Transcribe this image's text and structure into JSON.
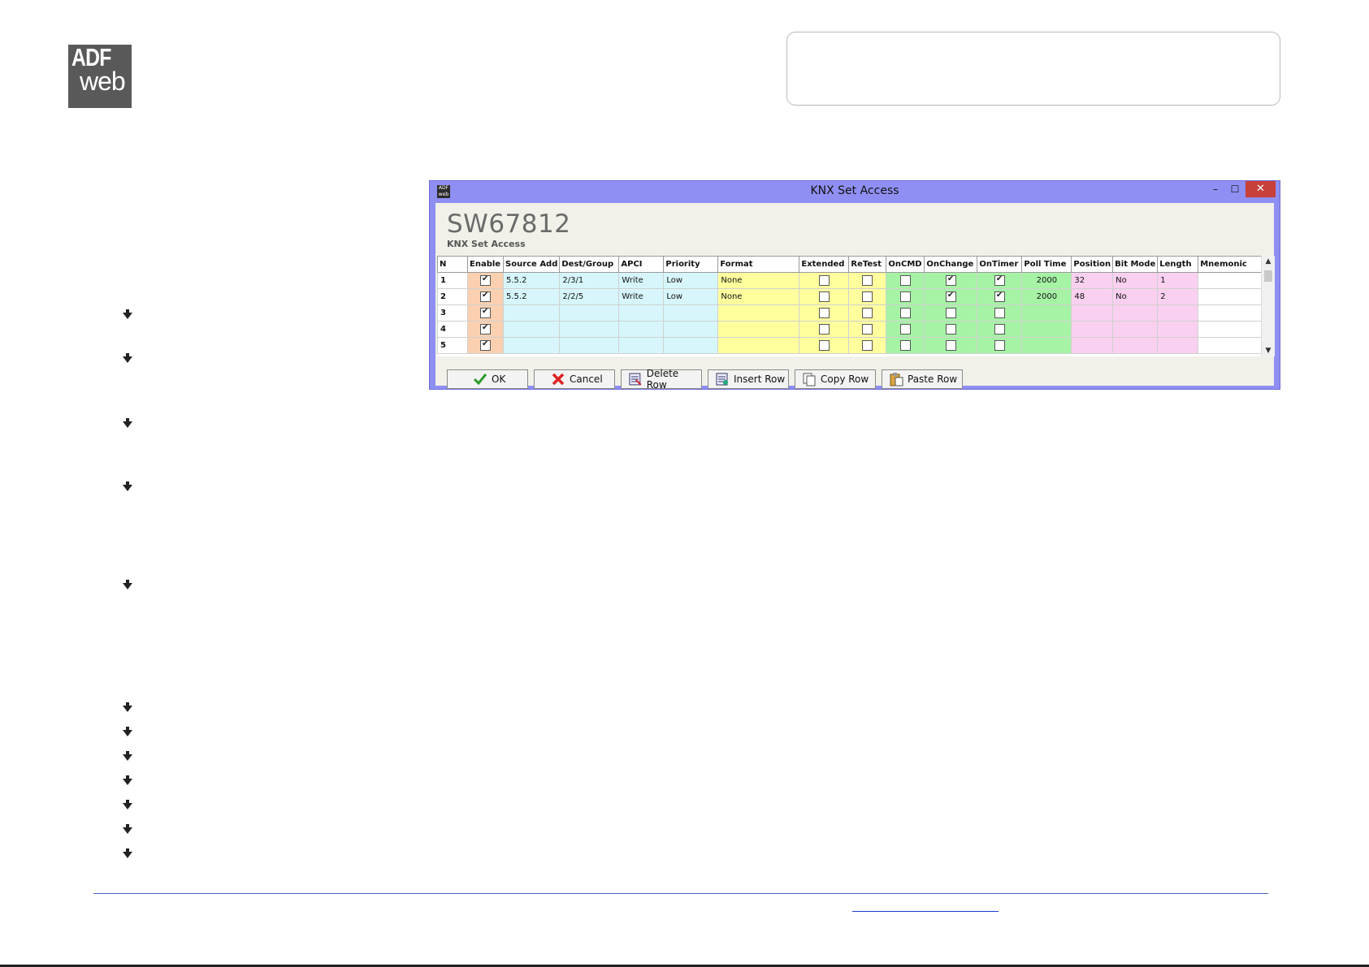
{
  "logo": {
    "line1": "ADF",
    "line2": "web"
  },
  "window": {
    "title": "KNX Set Access",
    "icon_text": "ADF web",
    "controls": {
      "minimize": "–",
      "maximize": "☐",
      "close": "✕"
    },
    "heading": "SW67812",
    "subheading": "KNX Set Access"
  },
  "grid": {
    "columns": [
      "N",
      "Enable",
      "Source Add",
      "Dest/Group",
      "APCI",
      "Priority",
      "Format",
      "Extended",
      "ReTest",
      "OnCMD",
      "OnChange",
      "OnTimer",
      "Poll Time",
      "Position",
      "Bit Mode",
      "Length",
      "Mnemonic"
    ],
    "rows": [
      {
        "n": "1",
        "enable": true,
        "source": "5.5.2",
        "dest": "2/3/1",
        "apci": "Write",
        "priority": "Low",
        "format": "None",
        "extended": false,
        "retest": false,
        "oncmd": false,
        "onchange": true,
        "ontimer": true,
        "poll": "2000",
        "position": "32",
        "bitmode": "No",
        "length": "1",
        "mnemonic": ""
      },
      {
        "n": "2",
        "enable": true,
        "source": "5.5.2",
        "dest": "2/2/5",
        "apci": "Write",
        "priority": "Low",
        "format": "None",
        "extended": false,
        "retest": false,
        "oncmd": false,
        "onchange": true,
        "ontimer": true,
        "poll": "2000",
        "position": "48",
        "bitmode": "No",
        "length": "2",
        "mnemonic": ""
      },
      {
        "n": "3",
        "enable": true,
        "source": "",
        "dest": "",
        "apci": "",
        "priority": "",
        "format": "",
        "extended": false,
        "retest": false,
        "oncmd": false,
        "onchange": false,
        "ontimer": false,
        "poll": "",
        "position": "",
        "bitmode": "",
        "length": "",
        "mnemonic": ""
      },
      {
        "n": "4",
        "enable": true,
        "source": "",
        "dest": "",
        "apci": "",
        "priority": "",
        "format": "",
        "extended": false,
        "retest": false,
        "oncmd": false,
        "onchange": false,
        "ontimer": false,
        "poll": "",
        "position": "",
        "bitmode": "",
        "length": "",
        "mnemonic": ""
      },
      {
        "n": "5",
        "enable": true,
        "source": "",
        "dest": "",
        "apci": "",
        "priority": "",
        "format": "",
        "extended": false,
        "retest": false,
        "oncmd": false,
        "onchange": false,
        "ontimer": false,
        "poll": "",
        "position": "",
        "bitmode": "",
        "length": "",
        "mnemonic": ""
      }
    ]
  },
  "buttons": {
    "ok": "OK",
    "cancel": "Cancel",
    "delete_row": "Delete Row",
    "insert_row": "Insert Row",
    "copy_row": "Copy Row",
    "paste_row": "Paste Row"
  },
  "colors": {
    "title_bar": "#8f8ff3",
    "enable_col": "#fad0b0",
    "address_cols": "#d6f6fc",
    "format_cols": "#ffff9e",
    "trigger_cols": "#a6f3a6",
    "data_cols": "#fad0f0",
    "close_button": "#c7403a",
    "footer_line": "#4b5fc4"
  }
}
